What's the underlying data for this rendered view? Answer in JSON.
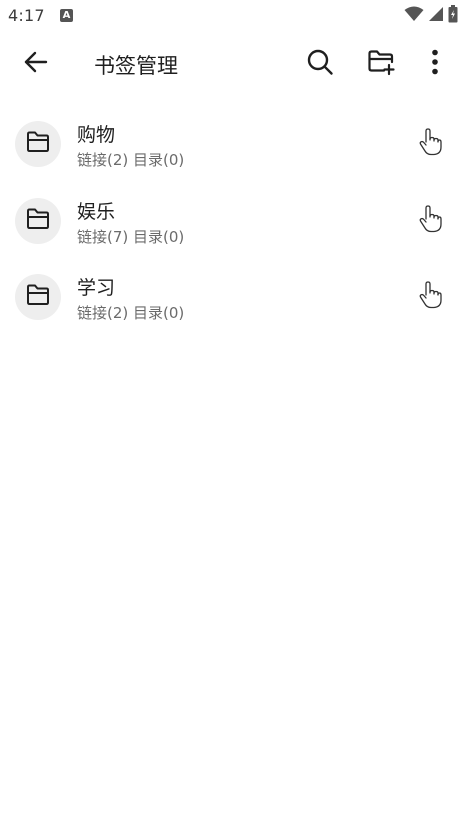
{
  "status_bar": {
    "time": "4:17",
    "notification_badge": "A",
    "icons": [
      "wifi-icon",
      "signal-icon",
      "battery-icon"
    ]
  },
  "app_bar": {
    "title": "书签管理",
    "actions": [
      "back-arrow-icon",
      "search-icon",
      "add-folder-icon",
      "more-vert-icon"
    ]
  },
  "folders": [
    {
      "name": "购物",
      "summary": "链接(2) 目录(0)",
      "icon": "folder-icon",
      "handle_icon": "touch-hand-icon"
    },
    {
      "name": "娱乐",
      "summary": "链接(7) 目录(0)",
      "icon": "folder-icon",
      "handle_icon": "touch-hand-icon"
    },
    {
      "name": "学习",
      "summary": "链接(2) 目录(0)",
      "icon": "folder-icon",
      "handle_icon": "touch-hand-icon"
    }
  ],
  "colors": {
    "background": "#ffffff",
    "avatar_bg": "#eeeeee",
    "text_primary": "#1f1f1f",
    "text_secondary": "#6b6b6b"
  }
}
